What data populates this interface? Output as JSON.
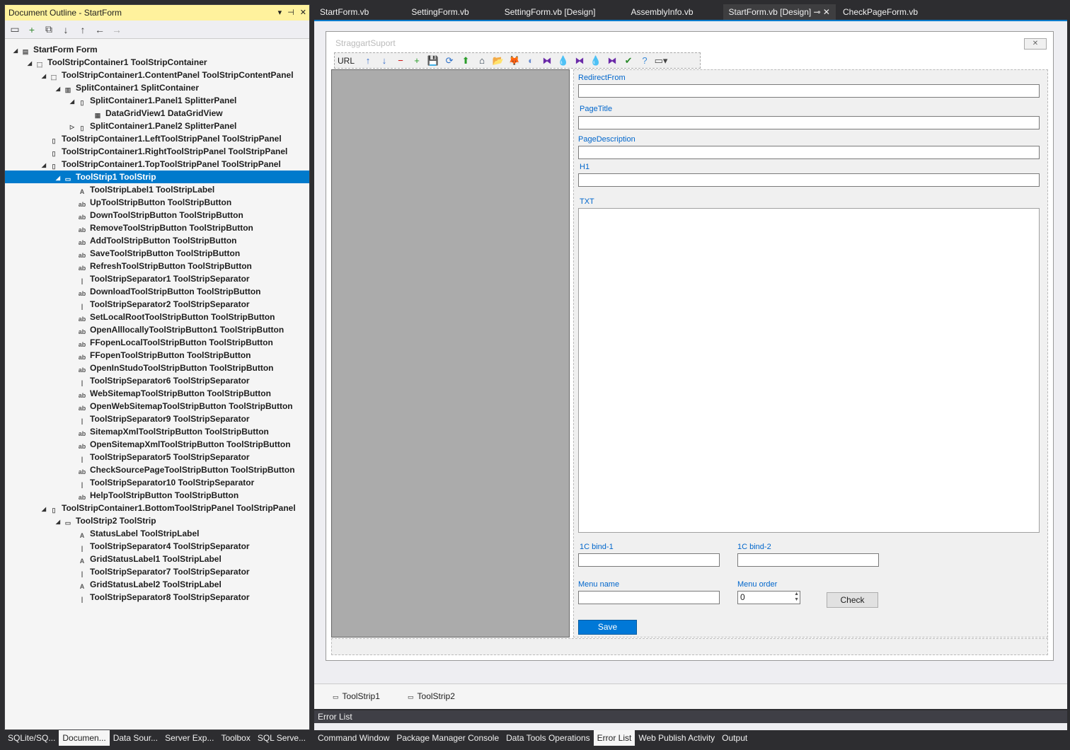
{
  "outline": {
    "title": "Document Outline - StartForm",
    "header_icons": [
      "▾",
      "⊣",
      "✕"
    ],
    "toolbar_icons": [
      "page-icon",
      "add-icon",
      "copy-icon",
      "arrow-down-icon",
      "arrow-up-icon",
      "arrow-left-icon",
      "arrow-right-icon"
    ],
    "nodes": [
      {
        "text": "StartForm  Form",
        "exp": "◢",
        "icon": "form-icon"
      },
      {
        "text": "ToolStripContainer1  ToolStripContainer",
        "exp": "◢",
        "icon": "container-icon"
      },
      {
        "text": "ToolStripContainer1.ContentPanel  ToolStripContentPanel",
        "exp": "◢",
        "icon": "container-icon"
      },
      {
        "text": "SplitContainer1  SplitContainer",
        "exp": "◢",
        "icon": "split-icon"
      },
      {
        "text": "SplitContainer1.Panel1  SplitterPanel",
        "exp": "◢",
        "icon": "panel-icon"
      },
      {
        "text": "DataGridView1  DataGridView",
        "exp": "",
        "icon": "grid-icon"
      },
      {
        "text": "SplitContainer1.Panel2  SplitterPanel",
        "exp": "▷",
        "icon": "panel-icon"
      },
      {
        "text": "ToolStripContainer1.LeftToolStripPanel  ToolStripPanel",
        "exp": "",
        "icon": "panel-icon"
      },
      {
        "text": "ToolStripContainer1.RightToolStripPanel  ToolStripPanel",
        "exp": "",
        "icon": "panel-icon"
      },
      {
        "text": "ToolStripContainer1.TopToolStripPanel  ToolStripPanel",
        "exp": "◢",
        "icon": "panel-icon"
      },
      {
        "text": "ToolStrip1  ToolStrip",
        "exp": "◢",
        "icon": "toolstrip-icon"
      },
      {
        "text": "ToolStripLabel1  ToolStripLabel",
        "exp": "",
        "icon": "label-icon"
      },
      {
        "text": "UpToolStripButton  ToolStripButton",
        "exp": "",
        "icon": "button-icon"
      },
      {
        "text": "DownToolStripButton  ToolStripButton",
        "exp": "",
        "icon": "button-icon"
      },
      {
        "text": "RemoveToolStripButton  ToolStripButton",
        "exp": "",
        "icon": "button-icon"
      },
      {
        "text": "AddToolStripButton  ToolStripButton",
        "exp": "",
        "icon": "button-icon"
      },
      {
        "text": "SaveToolStripButton  ToolStripButton",
        "exp": "",
        "icon": "button-icon"
      },
      {
        "text": "RefreshToolStripButton  ToolStripButton",
        "exp": "",
        "icon": "button-icon"
      },
      {
        "text": "ToolStripSeparator1  ToolStripSeparator",
        "exp": "",
        "icon": "separator-icon"
      },
      {
        "text": "DownloadToolStripButton  ToolStripButton",
        "exp": "",
        "icon": "button-icon"
      },
      {
        "text": "ToolStripSeparator2  ToolStripSeparator",
        "exp": "",
        "icon": "separator-icon"
      },
      {
        "text": "SetLocalRootToolStripButton  ToolStripButton",
        "exp": "",
        "icon": "button-icon"
      },
      {
        "text": "OpenAlllocallyToolStripButton1  ToolStripButton",
        "exp": "",
        "icon": "button-icon"
      },
      {
        "text": "FFopenLocalToolStripButton  ToolStripButton",
        "exp": "",
        "icon": "button-icon"
      },
      {
        "text": "FFopenToolStripButton  ToolStripButton",
        "exp": "",
        "icon": "button-icon"
      },
      {
        "text": "OpenInStudoToolStripButton  ToolStripButton",
        "exp": "",
        "icon": "button-icon"
      },
      {
        "text": "ToolStripSeparator6  ToolStripSeparator",
        "exp": "",
        "icon": "separator-icon"
      },
      {
        "text": "WebSitemapToolStripButton  ToolStripButton",
        "exp": "",
        "icon": "button-icon"
      },
      {
        "text": "OpenWebSitemapToolStripButton  ToolStripButton",
        "exp": "",
        "icon": "button-icon"
      },
      {
        "text": "ToolStripSeparator9  ToolStripSeparator",
        "exp": "",
        "icon": "separator-icon"
      },
      {
        "text": "SitemapXmlToolStripButton  ToolStripButton",
        "exp": "",
        "icon": "button-icon"
      },
      {
        "text": "OpenSitemapXmlToolStripButton  ToolStripButton",
        "exp": "",
        "icon": "button-icon"
      },
      {
        "text": "ToolStripSeparator5  ToolStripSeparator",
        "exp": "",
        "icon": "separator-icon"
      },
      {
        "text": "CheckSourcePageToolStripButton  ToolStripButton",
        "exp": "",
        "icon": "button-icon"
      },
      {
        "text": "ToolStripSeparator10  ToolStripSeparator",
        "exp": "",
        "icon": "separator-icon"
      },
      {
        "text": "HelpToolStripButton  ToolStripButton",
        "exp": "",
        "icon": "button-icon"
      },
      {
        "text": "ToolStripContainer1.BottomToolStripPanel  ToolStripPanel",
        "exp": "◢",
        "icon": "panel-icon"
      },
      {
        "text": "ToolStrip2  ToolStrip",
        "exp": "◢",
        "icon": "toolstrip-icon"
      },
      {
        "text": "StatusLabel  ToolStripLabel",
        "exp": "",
        "icon": "label-icon"
      },
      {
        "text": "ToolStripSeparator4  ToolStripSeparator",
        "exp": "",
        "icon": "separator-icon"
      },
      {
        "text": "GridStatusLabel1  ToolStripLabel",
        "exp": "",
        "icon": "label-icon"
      },
      {
        "text": "ToolStripSeparator7  ToolStripSeparator",
        "exp": "",
        "icon": "separator-icon"
      },
      {
        "text": "GridStatusLabel2  ToolStripLabel",
        "exp": "",
        "icon": "label-icon"
      },
      {
        "text": "ToolStripSeparator8  ToolStripSeparator",
        "exp": "",
        "icon": "separator-icon"
      }
    ],
    "selected_index": 10
  },
  "bottom_tabs_left": [
    "SQLite/SQ...",
    "Documen...",
    "Data Sour...",
    "Server Exp...",
    "Toolbox",
    "SQL Serve..."
  ],
  "bottom_tabs_left_active": 1,
  "editor_tabs": [
    "StartForm.vb",
    "SettingForm.vb",
    "SettingForm.vb [Design]",
    "AssemblyInfo.vb",
    "StartForm.vb [Design]",
    "CheckPageForm.vb"
  ],
  "editor_tab_active": 4,
  "editor_tab_active_icons": "⊸ ✕",
  "form": {
    "title": "StraggartSuport",
    "close_glyph": "✕",
    "toolstrip_label": "URL",
    "toolstrip_icons": [
      "↑",
      "↓",
      "−",
      "+",
      "💾",
      "⟳",
      "⬆",
      "⌂",
      "📂",
      "🦊",
      "◐",
      "⧓",
      "💧",
      "⧓",
      "💧",
      "⧓",
      "✔",
      "?",
      "▭▾"
    ],
    "labels": {
      "redirect_from": "RedirectFrom",
      "page_title": "PageTitle",
      "page_description": "PageDescription",
      "h1": "H1",
      "txt": "TXT",
      "bind1": "1C bind-1",
      "bind2": "1C bind-2",
      "menu_name": "Menu name",
      "menu_order": "Menu order"
    },
    "menu_order_value": "0",
    "check_label": "Check",
    "save_label": "Save"
  },
  "tray": {
    "items": [
      "ToolStrip1",
      "ToolStrip2"
    ]
  },
  "error_list": {
    "title": "Error List"
  },
  "bottom_tabs_right": [
    "Command Window",
    "Package Manager Console",
    "Data Tools Operations",
    "Error List",
    "Web Publish Activity",
    "Output"
  ],
  "bottom_tabs_right_active": 3,
  "colors": {
    "accent": "#007acc",
    "selection": "#007acc",
    "header_yellow": "#fff29d",
    "label_blue": "#0066cc"
  }
}
